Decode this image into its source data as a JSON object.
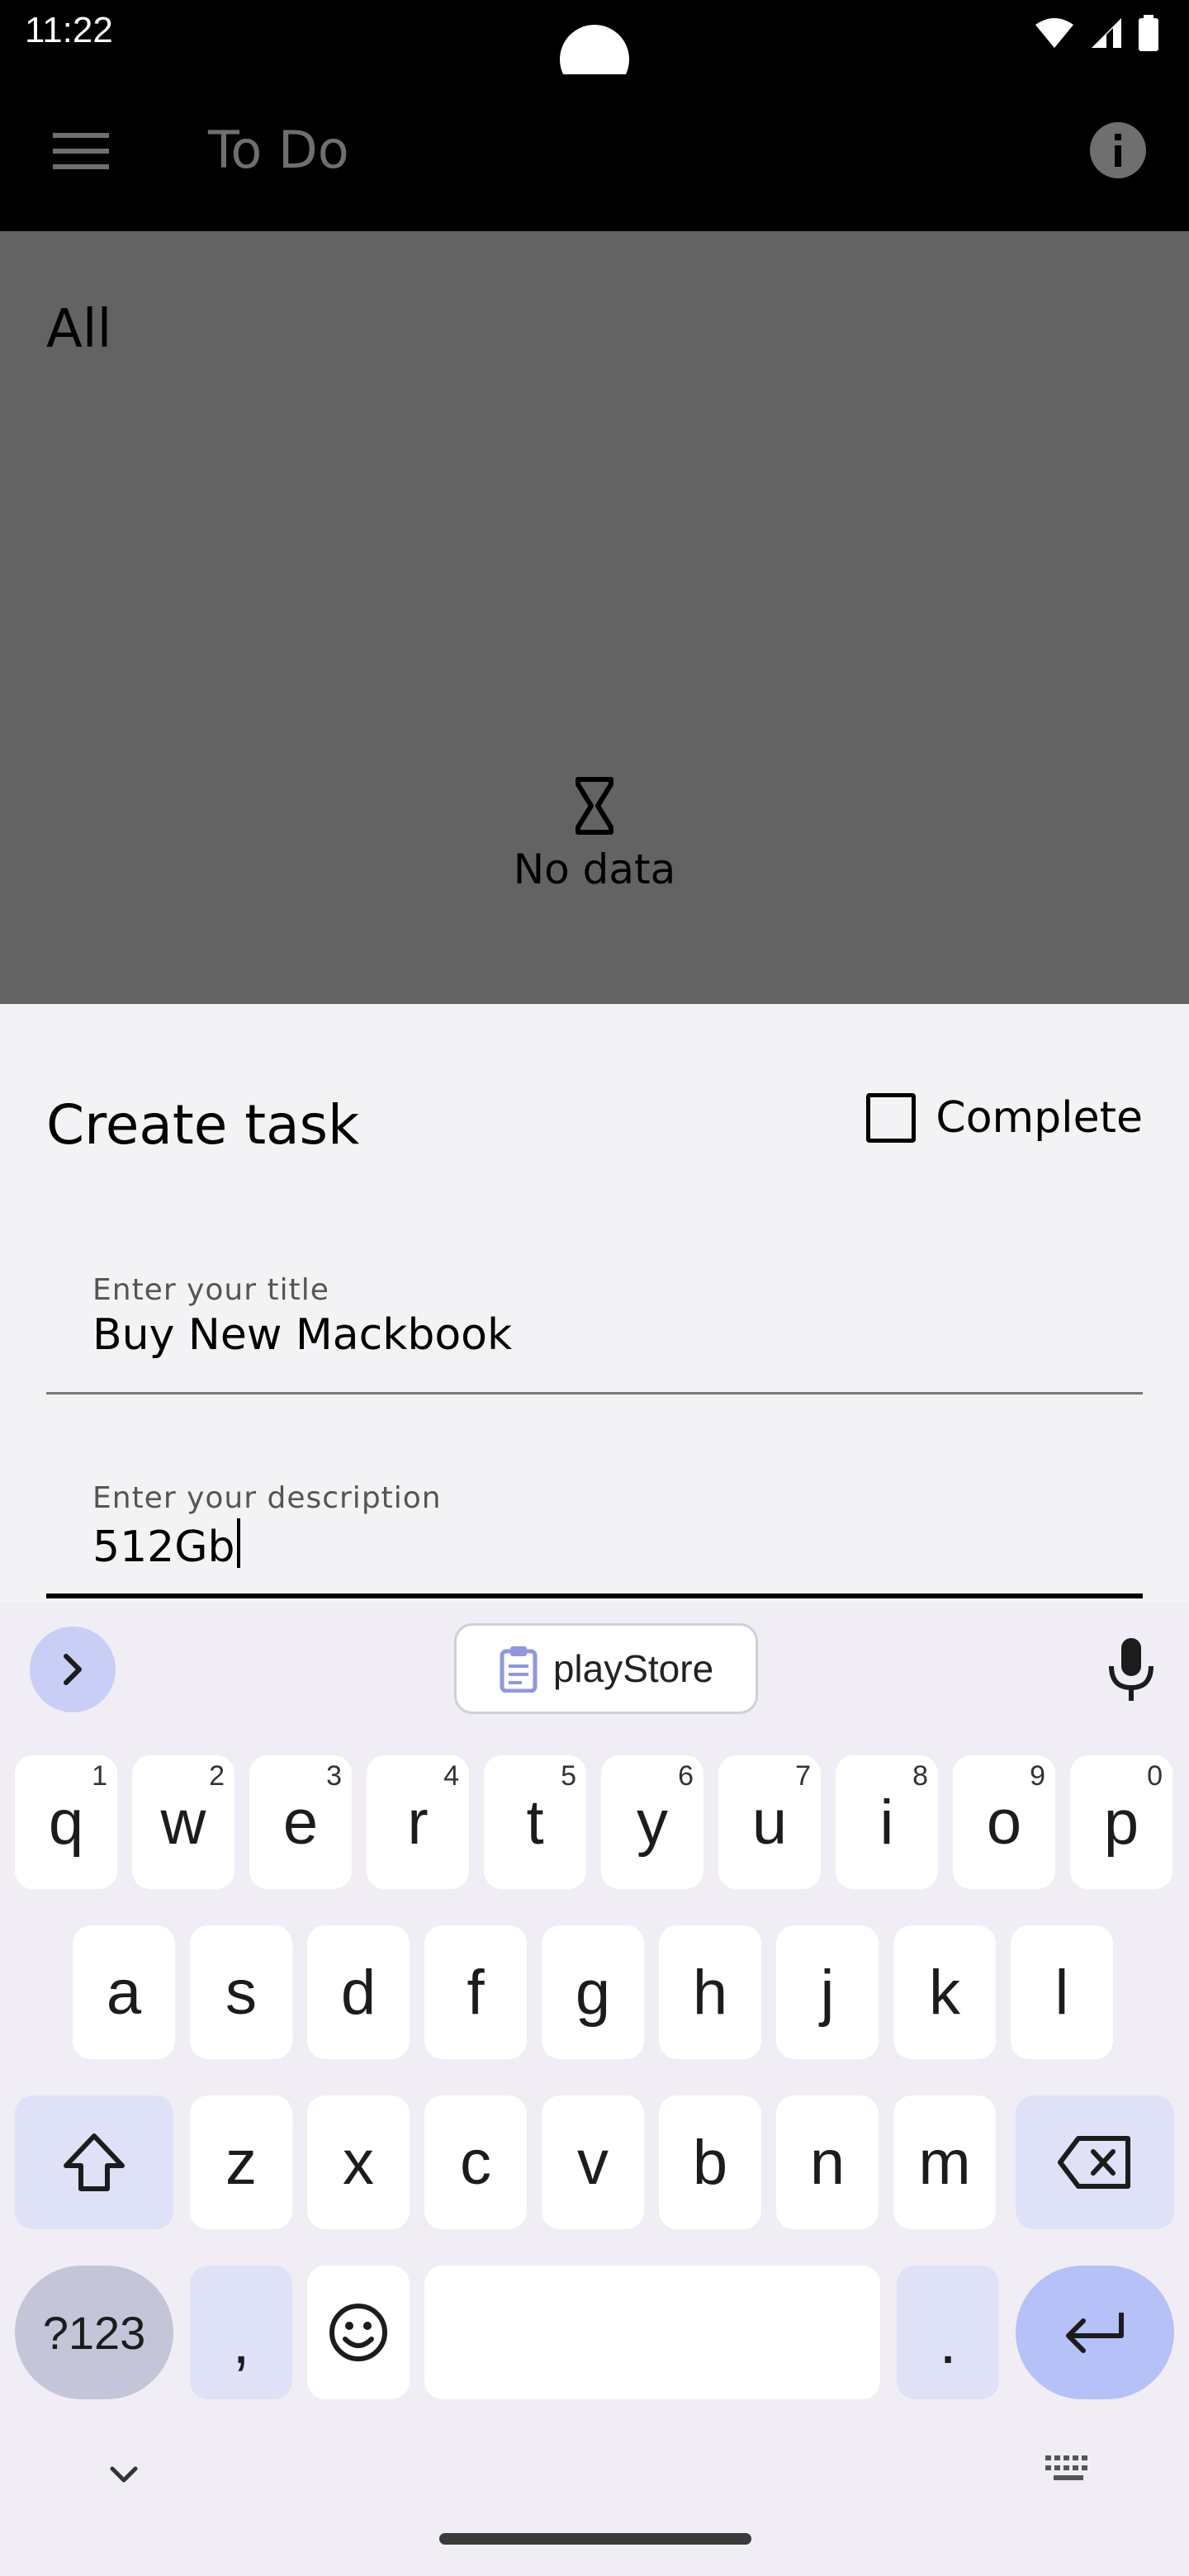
{
  "status_bar": {
    "time": "11:22"
  },
  "app_bar": {
    "title": "To Do"
  },
  "content": {
    "filter": "All",
    "empty_text": "No data"
  },
  "sheet": {
    "title": "Create task",
    "complete_label": "Complete",
    "title_field": {
      "label": "Enter your title",
      "value": "Buy New Mackbook"
    },
    "description_field": {
      "label": "Enter your description",
      "value": "512Gb"
    }
  },
  "keyboard": {
    "clipboard_chip": "playStore",
    "row1": [
      {
        "k": "q",
        "h": "1"
      },
      {
        "k": "w",
        "h": "2"
      },
      {
        "k": "e",
        "h": "3"
      },
      {
        "k": "r",
        "h": "4"
      },
      {
        "k": "t",
        "h": "5"
      },
      {
        "k": "y",
        "h": "6"
      },
      {
        "k": "u",
        "h": "7"
      },
      {
        "k": "i",
        "h": "8"
      },
      {
        "k": "o",
        "h": "9"
      },
      {
        "k": "p",
        "h": "0"
      }
    ],
    "row2": [
      "a",
      "s",
      "d",
      "f",
      "g",
      "h",
      "j",
      "k",
      "l"
    ],
    "row3": [
      "z",
      "x",
      "c",
      "v",
      "b",
      "n",
      "m"
    ],
    "symbols_label": "?123",
    "comma": ",",
    "period": "."
  },
  "icons": {
    "menu": "menu-icon",
    "info": "info-icon",
    "hourglass": "hourglass-icon",
    "clipboard": "clipboard-icon",
    "mic": "mic-icon",
    "shift": "shift-icon",
    "backspace": "backspace-icon",
    "emoji": "emoji-icon",
    "enter": "enter-icon"
  },
  "colors": {
    "app_bar_bg": "#000000",
    "dim_overlay": "#636363",
    "sheet_bg": "#f3f3f5",
    "keyboard_bg": "#f0edf4",
    "modifier_key": "#dfe1f7",
    "enter_key": "#b5c1f7"
  }
}
